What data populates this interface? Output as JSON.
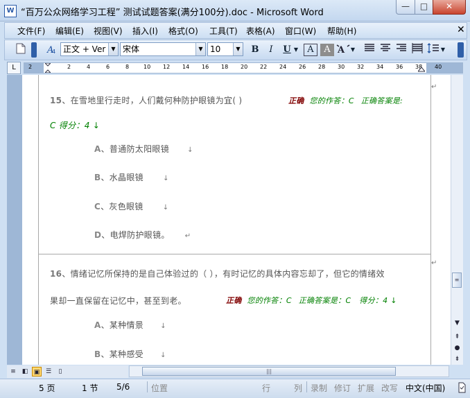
{
  "window": {
    "title": "“百万公众网络学习工程” 测试试题答案(满分100分).doc - Microsoft Word",
    "app_icon": "W",
    "minimize_icon": "—",
    "maximize_icon": "□",
    "close_icon": "✕"
  },
  "menu": {
    "items": [
      "文件(F)",
      "编辑(E)",
      "视图(V)",
      "插入(I)",
      "格式(O)",
      "工具(T)",
      "表格(A)",
      "窗口(W)",
      "帮助(H)"
    ],
    "close_icon": "✕"
  },
  "toolbar": {
    "style_value": "正文 + Ver",
    "font_value": "宋体",
    "size_value": "10",
    "bold": "B",
    "italic": "I",
    "underline": "U",
    "font_color_a": "A",
    "char_shade_a": "A"
  },
  "ruler": {
    "corner": "L",
    "ticks": [
      "2",
      "2",
      "4",
      "6",
      "8",
      "10",
      "12",
      "14",
      "16",
      "18",
      "20",
      "22",
      "24",
      "26",
      "28",
      "30",
      "32",
      "34",
      "36",
      "38",
      "40"
    ]
  },
  "document": {
    "q15": {
      "number": "15",
      "question": "、在雪地里行走时，人们戴何种防护眼镜为宜( )",
      "correct_label": "正确",
      "your_answer": "您的作答：C",
      "right_answer": "正确答案是:",
      "cont": "C  得分：4 ↓",
      "options": [
        {
          "letter": "A",
          "text": "、普通防太阳眼镜",
          "mark": "↓"
        },
        {
          "letter": "B",
          "text": "、水晶眼镜",
          "mark": "↓"
        },
        {
          "letter": "C",
          "text": "、灰色眼镜",
          "mark": "↓"
        },
        {
          "letter": "D",
          "text": "、电焊防护眼镜。",
          "mark": "↵"
        }
      ]
    },
    "q16": {
      "number": "16",
      "question_line1": "、情绪记忆所保持的是自己体验过的（ ），有时记忆的具体内容忘却了，但它的情绪效",
      "question_line2": "果却一直保留在记忆中，甚至到老。",
      "correct_label": "正确",
      "your_answer": "您的作答：C",
      "right_answer": "正确答案是：C",
      "score": "得分：4 ↓",
      "options": [
        {
          "letter": "A",
          "text": "、某种情景",
          "mark": "↓"
        },
        {
          "letter": "B",
          "text": "、某种感受",
          "mark": "↓"
        }
      ]
    },
    "para_marks": [
      "↵",
      "↵"
    ]
  },
  "status": {
    "page": "5 页",
    "section": "1 节",
    "page_of": "5/6",
    "position": "位置",
    "line": "行",
    "column": "列",
    "rec": "录制",
    "trk": "修订",
    "ext": "扩展",
    "ovr": "改写",
    "language": "中文(中国)"
  }
}
